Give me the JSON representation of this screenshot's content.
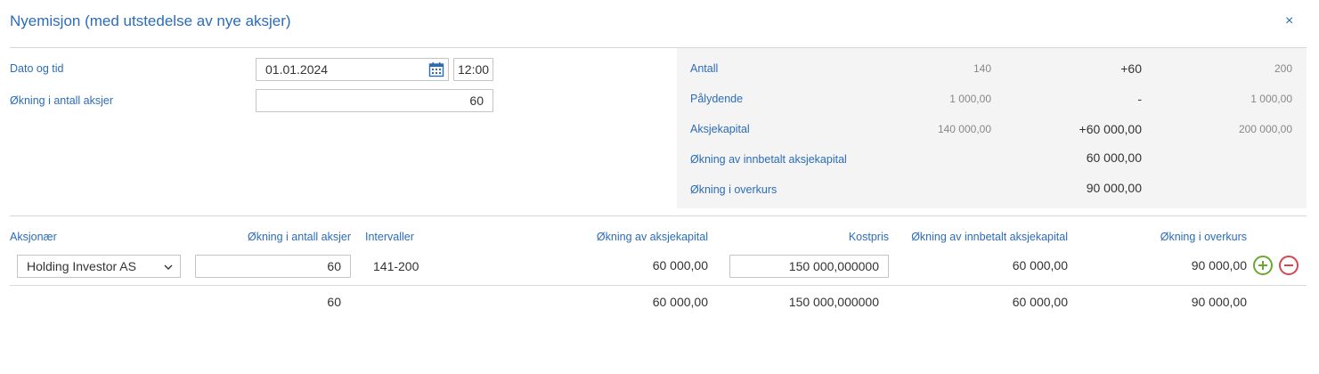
{
  "dialog": {
    "title": "Nyemisjon (med utstedelse av nye aksjer)",
    "close_label": "×"
  },
  "form": {
    "date_label": "Dato og tid",
    "date_value": "01.01.2024",
    "time_value": "12:00",
    "increase_label": "Økning i antall aksjer",
    "increase_value": "60"
  },
  "summary": {
    "rows": [
      {
        "label": "Antall",
        "old": "140",
        "change": "+60",
        "new": "200"
      },
      {
        "label": "Pålydende",
        "old": "1 000,00",
        "change": "-",
        "new": "1 000,00"
      },
      {
        "label": "Aksjekapital",
        "old": "140 000,00",
        "change": "+60 000,00",
        "new": "200 000,00"
      },
      {
        "label": "Økning av innbetalt aksjekapital",
        "old": "",
        "change": "60 000,00",
        "new": ""
      },
      {
        "label": "Økning i overkurs",
        "old": "",
        "change": "90 000,00",
        "new": ""
      }
    ]
  },
  "table": {
    "headers": {
      "shareholder": "Aksjonær",
      "increase": "Økning i antall aksjer",
      "intervals": "Intervaller",
      "capital_increase": "Økning av aksjekapital",
      "cost_price": "Kostpris",
      "paid_in_increase": "Økning av innbetalt aksjekapital",
      "premium_increase": "Økning i overkurs"
    },
    "row": {
      "shareholder": "Holding Investor AS",
      "increase": "60",
      "intervals": "141-200",
      "capital_increase": "60 000,00",
      "cost_price": "150 000,000000",
      "paid_in_increase": "60 000,00",
      "premium_increase": "90 000,00"
    },
    "totals": {
      "increase": "60",
      "capital_increase": "60 000,00",
      "cost_price": "150 000,000000",
      "paid_in_increase": "60 000,00",
      "premium_increase": "90 000,00"
    }
  },
  "icons": {
    "calendar": "calendar-icon",
    "chevron": "chevron-down-icon",
    "add": "plus-circle-icon",
    "remove": "minus-circle-icon"
  },
  "colors": {
    "accent": "#2b6cb8",
    "add": "#6aa82f",
    "remove": "#d7464f",
    "summary_bg": "#f4f4f4"
  }
}
